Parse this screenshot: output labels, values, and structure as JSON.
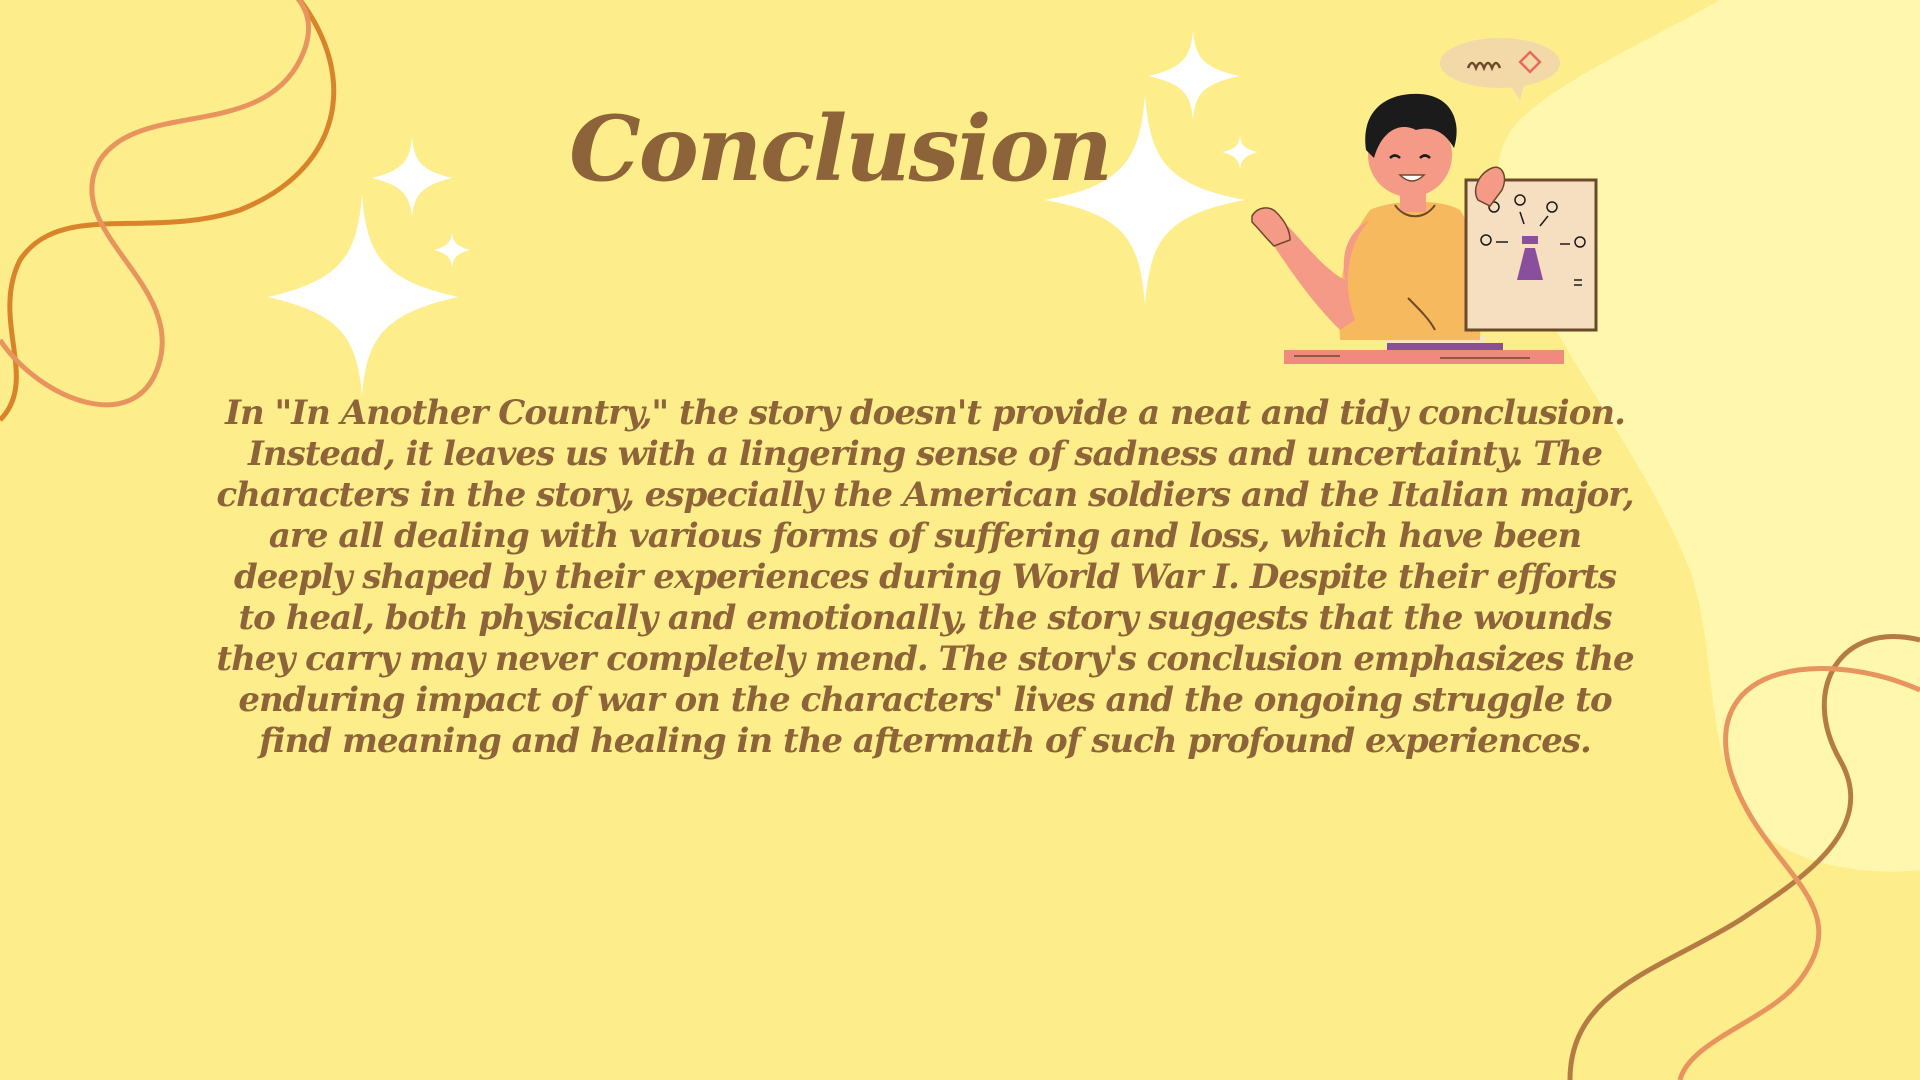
{
  "slide": {
    "title": "Conclusion",
    "body": "In \"In Another Country,\" the story doesn't provide a neat and tidy conclusion. Instead, it leaves us with a lingering sense of sadness and uncertainty. The characters in the story, especially the American soldiers and the Italian major, are all dealing with various forms of suffering and loss, which have been deeply shaped by their experiences during World War I. Despite their efforts to heal, both physically and emotionally, the story suggests that the wounds they carry may never completely mend. The story's conclusion emphasizes the enduring impact of war on the characters' lives and the ongoing struggle to find meaning and healing in the aftermath of such profound experiences."
  },
  "colors": {
    "background": "#feed8b",
    "blob": "#fff7ad",
    "text": "#8d6339",
    "curve_orange": "#d9842a",
    "curve_salmon": "#e8945f",
    "curve_brown": "#b57b45",
    "sparkle": "#ffffff"
  },
  "illustration": {
    "description_icon": "teacher-presenting-icon"
  }
}
